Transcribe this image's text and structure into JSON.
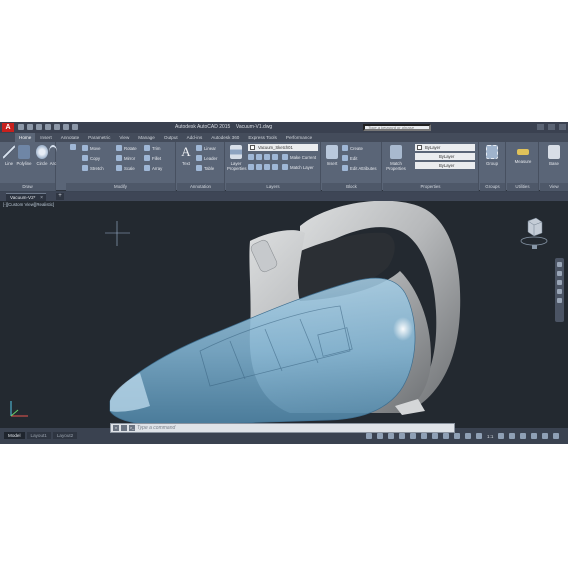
{
  "app": {
    "title": "Autodesk AutoCAD 2015",
    "filename": "Vacuum-V1.dwg",
    "logo": "A"
  },
  "search": {
    "placeholder": "Type a keyword or phrase"
  },
  "ribbon": {
    "tabs": [
      "Home",
      "Insert",
      "Annotate",
      "Parametric",
      "View",
      "Manage",
      "Output",
      "Add-ins",
      "Autodesk 360",
      "Express Tools",
      "Performance"
    ],
    "active_tab": "Home",
    "draw": {
      "title": "Draw",
      "line": "Line",
      "polyline": "Polyline",
      "circle": "Circle",
      "arc": "Arc"
    },
    "modify": {
      "title": "Modify",
      "move": "Move",
      "rotate": "Rotate",
      "trim": "Trim",
      "copy": "Copy",
      "mirror": "Mirror",
      "fillet": "Fillet",
      "stretch": "Stretch",
      "scale": "Scale",
      "array": "Array"
    },
    "annotation": {
      "title": "Annotation",
      "text": "Text",
      "linear": "Linear",
      "leader": "Leader",
      "table": "Table"
    },
    "layers": {
      "title": "Layers",
      "layer_properties": "Layer Properties",
      "current_layer": "Vacuum_Sketch01",
      "make_current": "Make Current",
      "match_layer": "Match Layer"
    },
    "block": {
      "title": "Block",
      "insert": "Insert",
      "create": "Create",
      "edit": "Edit",
      "edit_attributes": "Edit Attributes"
    },
    "properties": {
      "title": "Properties",
      "match_properties": "Match Properties",
      "color": "ByLayer",
      "linetype": "ByLayer",
      "lineweight": "ByLayer"
    },
    "groups": {
      "title": "Groups",
      "group": "Group"
    },
    "utilities": {
      "title": "Utilities",
      "measure": "Measure"
    },
    "view": {
      "title": "View",
      "base": "Base"
    }
  },
  "file_tab": {
    "label": "Vacuum-V2*",
    "close": "×",
    "new": "+"
  },
  "viewport": {
    "label": "[-][Custom View][Realistic]"
  },
  "command": {
    "placeholder": "Type a command",
    "prompt": ">_"
  },
  "status": {
    "layouts": [
      "Model",
      "Layout1",
      "Layout2"
    ],
    "active_layout": "Model",
    "scale": "1:1"
  },
  "colors": {
    "app_bg": "#3b4453",
    "ribbon_bg": "#5a6577",
    "viewport_bg": "#232930",
    "model_body": "#a9abad",
    "model_shell": "#7fb2d1"
  }
}
